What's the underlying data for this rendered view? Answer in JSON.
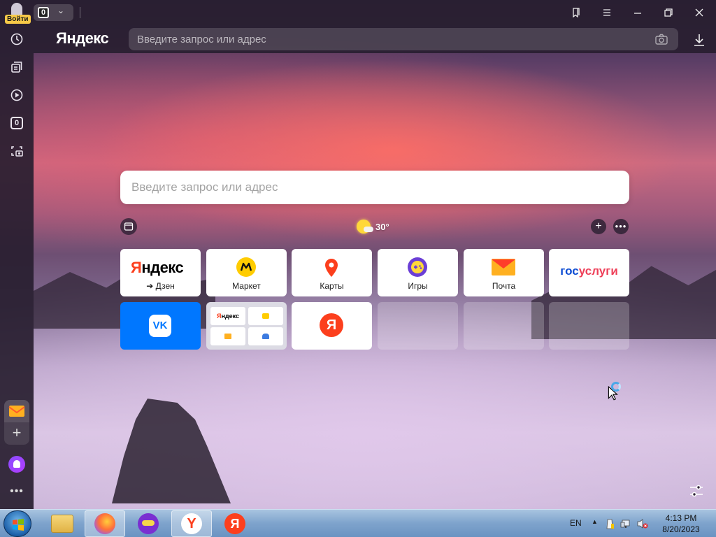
{
  "browser": {
    "brand": "Яндекс",
    "login_label": "Войти",
    "tab_count": "0",
    "address_placeholder": "Введите запрос или адрес"
  },
  "sidebar": {
    "items": [
      {
        "icon": "history-icon"
      },
      {
        "icon": "collections-icon"
      },
      {
        "icon": "video-icon"
      },
      {
        "icon": "counter-icon",
        "label": "0"
      },
      {
        "icon": "screenshot-icon"
      }
    ],
    "bottom": [
      {
        "icon": "mail-icon"
      },
      {
        "icon": "add-icon"
      },
      {
        "icon": "alice-icon"
      },
      {
        "icon": "more-icon"
      }
    ]
  },
  "newtab": {
    "search_placeholder": "Введите запрос или адрес",
    "weather_temp": "30°",
    "tiles": [
      {
        "label": "➔ Дзен",
        "logo": "Яндекс"
      },
      {
        "label": "Маркет"
      },
      {
        "label": "Карты"
      },
      {
        "label": "Игры"
      },
      {
        "label": "Почта"
      },
      {
        "label": "",
        "logo": "госуслуги"
      },
      {
        "label": "",
        "logo": "VK"
      },
      {
        "label": "",
        "group": [
          "Яндекс",
          "",
          "",
          ""
        ]
      },
      {
        "label": "",
        "logo": "Я"
      }
    ]
  },
  "taskbar": {
    "language": "EN",
    "time": "4:13 PM",
    "date": "8/20/2023"
  },
  "colors": {
    "yandex_red": "#fc3f1d",
    "vk_blue": "#0077ff",
    "gosuslugi_blue": "#0d4cd3",
    "gosuslugi_red": "#ee3f58",
    "market_yellow": "#ffcc00",
    "chrome_dark": "#2e2336"
  }
}
